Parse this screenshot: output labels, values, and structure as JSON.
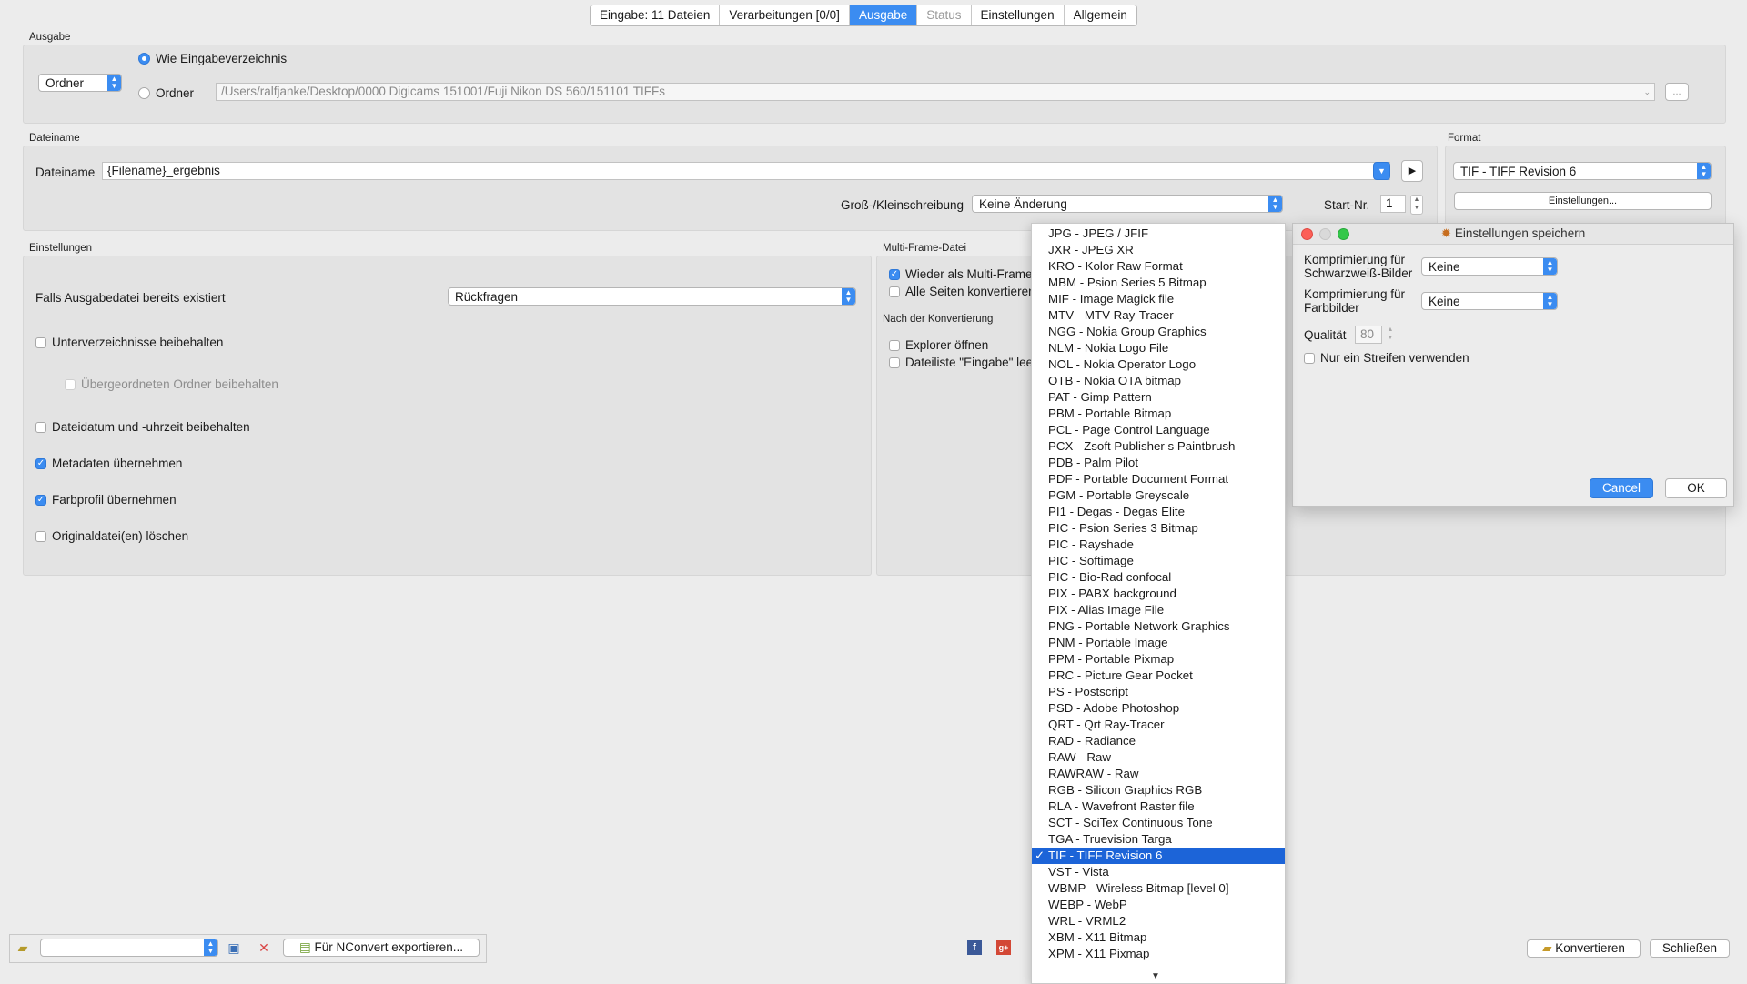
{
  "tabs": [
    {
      "label": "Eingabe: 11 Dateien",
      "state": "normal"
    },
    {
      "label": "Verarbeitungen [0/0]",
      "state": "normal"
    },
    {
      "label": "Ausgabe",
      "state": "active"
    },
    {
      "label": "Status",
      "state": "disabled"
    },
    {
      "label": "Einstellungen",
      "state": "normal"
    },
    {
      "label": "Allgemein",
      "state": "normal"
    }
  ],
  "ausgabe": {
    "section_label": "Ausgabe",
    "mode_popup": "Ordner",
    "radio_same_dir": "Wie Eingabeverzeichnis",
    "radio_folder": "Ordner",
    "folder_path": "/Users/ralfjanke/Desktop/0000 Digicams 151001/Fuji Nikon DS 560/151101 TIFFs",
    "browse_label": "..."
  },
  "dateiname": {
    "section_label": "Dateiname",
    "field_label": "Dateiname",
    "value": "{Filename}_ergebnis",
    "case_label": "Groß-/Kleinschreibung",
    "case_value": "Keine Änderung",
    "start_label": "Start-Nr.",
    "start_value": "1"
  },
  "format": {
    "section_label": "Format",
    "value": "TIF - TIFF Revision 6",
    "settings_button": "Einstellungen..."
  },
  "einstellungen": {
    "section_label": "Einstellungen",
    "exists_label": "Falls Ausgabedatei bereits existiert",
    "exists_value": "Rückfragen",
    "options": [
      {
        "label": "Unterverzeichnisse beibehalten",
        "checked": false,
        "disabled": false
      },
      {
        "label": "Übergeordneten Ordner beibehalten",
        "checked": false,
        "disabled": true
      },
      {
        "label": "Dateidatum und -uhrzeit beibehalten",
        "checked": false,
        "disabled": false
      },
      {
        "label": "Metadaten übernehmen",
        "checked": true,
        "disabled": false
      },
      {
        "label": "Farbprofil übernehmen",
        "checked": true,
        "disabled": false
      },
      {
        "label": "Originaldatei(en) löschen",
        "checked": false,
        "disabled": false
      }
    ]
  },
  "multiframe": {
    "section_label": "Multi-Frame-Datei",
    "opt1": "Wieder als Multi-Frame",
    "opt1_checked": true,
    "opt2": "Alle Seiten konvertieren",
    "opt2_checked": false
  },
  "nach_konvertierung": {
    "section_label": "Nach der Konvertierung",
    "opt1": "Explorer öffnen",
    "opt2": "Dateiliste \"Eingabe\" lee"
  },
  "format_list": {
    "items": [
      "JPG - JPEG / JFIF",
      "JXR - JPEG XR",
      "KRO - Kolor Raw Format",
      "MBM - Psion Series 5 Bitmap",
      "MIF - Image Magick file",
      "MTV - MTV Ray-Tracer",
      "NGG - Nokia Group Graphics",
      "NLM - Nokia Logo File",
      "NOL - Nokia Operator Logo",
      "OTB - Nokia OTA bitmap",
      "PAT - Gimp Pattern",
      "PBM - Portable Bitmap",
      "PCL - Page Control Language",
      "PCX - Zsoft Publisher s Paintbrush",
      "PDB - Palm Pilot",
      "PDF - Portable Document Format",
      "PGM - Portable Greyscale",
      "PI1 - Degas - Degas Elite",
      "PIC - Psion Series 3 Bitmap",
      "PIC - Rayshade",
      "PIC - Softimage",
      "PIC - Bio-Rad confocal",
      "PIX - PABX background",
      "PIX - Alias Image File",
      "PNG - Portable Network Graphics",
      "PNM - Portable Image",
      "PPM - Portable Pixmap",
      "PRC - Picture Gear Pocket",
      "PS - Postscript",
      "PSD - Adobe Photoshop",
      "QRT - Qrt Ray-Tracer",
      "RAD - Radiance",
      "RAW - Raw",
      "RAWRAW - Raw",
      "RGB - Silicon Graphics RGB",
      "RLA - Wavefront Raster file",
      "SCT - SciTex Continuous Tone",
      "TGA - Truevision Targa",
      "TIF - TIFF Revision 6",
      "VST - Vista",
      "WBMP - Wireless Bitmap [level 0]",
      "WEBP - WebP",
      "WRL - VRML2",
      "XBM - X11 Bitmap",
      "XPM - X11 Pixmap"
    ],
    "selected": "TIF - TIFF Revision 6",
    "check_glyph": "✓"
  },
  "dialog": {
    "title": "Einstellungen speichern",
    "bw_label": "Komprimierung für Schwarzweiß-Bilder",
    "bw_value": "Keine",
    "color_label": "Komprimierung für Farbbilder",
    "color_value": "Keine",
    "quality_label": "Qualität",
    "quality_value": "80",
    "strip_label": "Nur ein Streifen verwenden",
    "cancel": "Cancel",
    "ok": "OK"
  },
  "bottom": {
    "export_button": "Für NConvert exportieren...",
    "convert_button": "Konvertieren",
    "close_button": "Schließen"
  },
  "colors": {
    "accent": "#3b8cf1",
    "selection": "#1c64d8",
    "window_bg": "#ececec"
  }
}
